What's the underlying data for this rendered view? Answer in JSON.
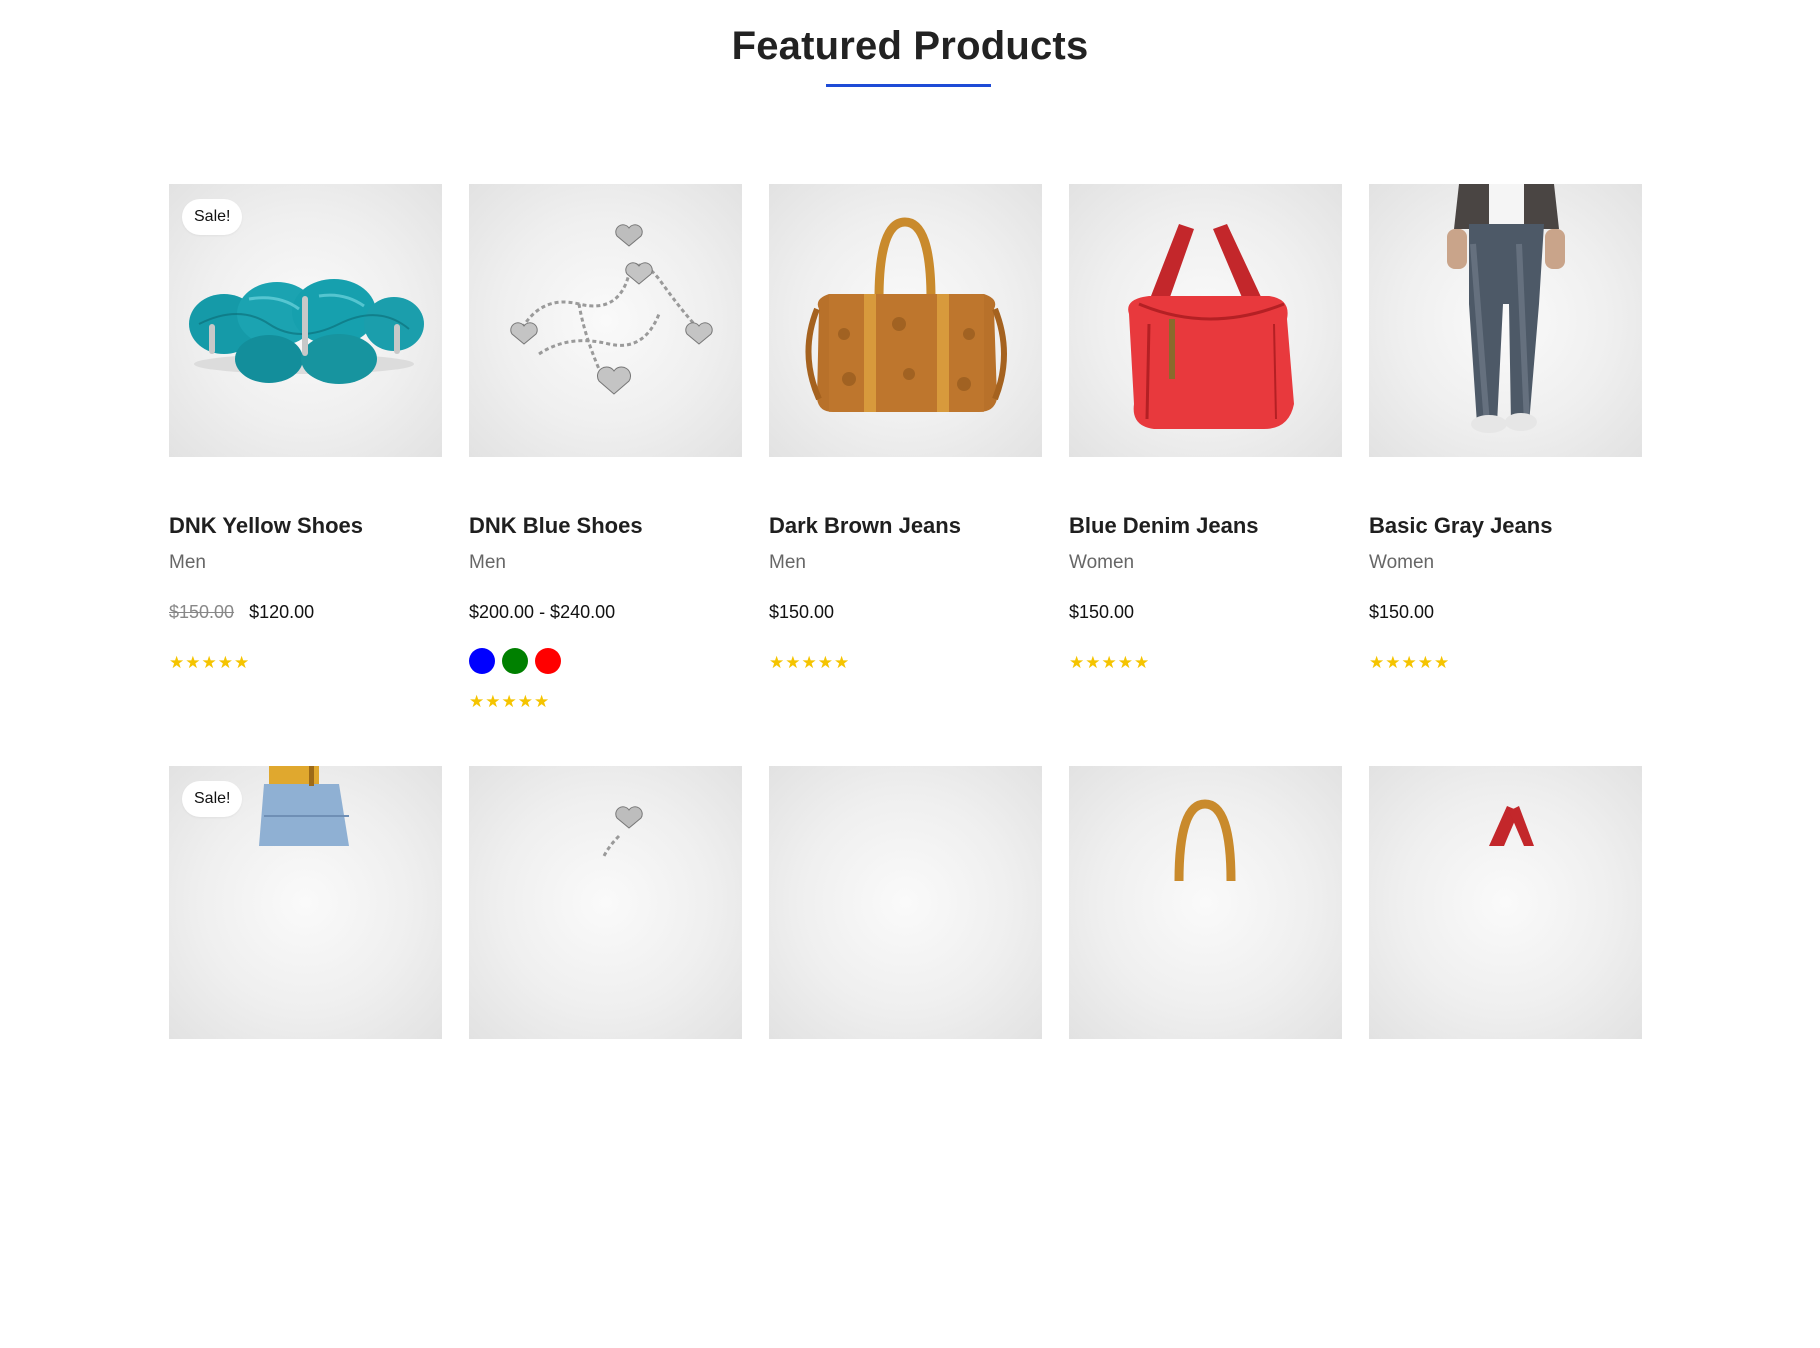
{
  "section": {
    "title": "Featured Products"
  },
  "colors": {
    "accent": "#1e4bd6",
    "star": "#f5c400"
  },
  "products": [
    {
      "name": "DNK Yellow Shoes",
      "category": "Men",
      "old_price": "$150.00",
      "price": "$120.00",
      "badge": "Sale!",
      "rating": "★★★★★",
      "image": "turquoise-bracelet"
    },
    {
      "name": "DNK Blue Shoes",
      "category": "Men",
      "price": "$200.00 - $240.00",
      "rating": "★★★★★",
      "swatches": [
        "#0000ff",
        "#008000",
        "#ff0000"
      ],
      "image": "silver-heart-bracelet"
    },
    {
      "name": "Dark Brown Jeans",
      "category": "Men",
      "price": "$150.00",
      "rating": "★★★★★",
      "image": "brown-duffel-bag"
    },
    {
      "name": "Blue Denim Jeans",
      "category": "Women",
      "price": "$150.00",
      "rating": "★★★★★",
      "image": "red-handbag"
    },
    {
      "name": "Basic Gray Jeans",
      "category": "Women",
      "price": "$150.00",
      "rating": "★★★★★",
      "image": "gray-jeans-model"
    }
  ],
  "second_row": [
    {
      "badge": "Sale!",
      "image": "denim-shorts-model"
    },
    {
      "image": "silver-heart-bracelet"
    },
    {
      "image": "blank"
    },
    {
      "image": "brown-duffel-bag"
    },
    {
      "image": "red-handbag"
    }
  ]
}
